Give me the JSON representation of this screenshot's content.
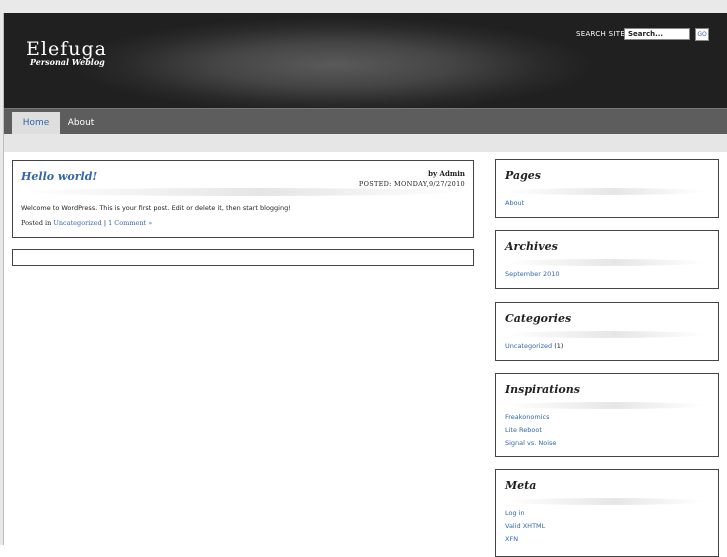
{
  "site": {
    "title": "Elefuga",
    "tagline": "Personal Weblog"
  },
  "search": {
    "label": "SEARCH SITE",
    "value": "Search...",
    "button": "GO"
  },
  "nav": {
    "tabs": [
      {
        "label": "Home",
        "active": true
      },
      {
        "label": "About",
        "active": false
      }
    ]
  },
  "post": {
    "title": "Hello world!",
    "byline": "by Admin",
    "date": "POSTED: MONDAY,9/27/2010",
    "body": "Welcome to WordPress. This is your first post. Edit or delete it, then start blogging!",
    "meta_prefix": "Posted in",
    "category": "Uncategorized",
    "separator": "|",
    "comments": "1 Comment »"
  },
  "sidebar": {
    "pages": {
      "title": "Pages",
      "items": [
        "About"
      ]
    },
    "archives": {
      "title": "Archives",
      "items": [
        "September 2010"
      ]
    },
    "categories": {
      "title": "Categories",
      "items": [
        {
          "label": "Uncategorized",
          "count": "(1)"
        }
      ]
    },
    "inspirations": {
      "title": "Inspirations",
      "items": [
        "Freakonomics",
        "Lite Reboot",
        "Signal vs. Noise"
      ]
    },
    "meta": {
      "title": "Meta",
      "items": [
        "Log in",
        "Valid XHTML",
        "XFN"
      ]
    }
  },
  "colors": {
    "link": "#3366aa",
    "header_bg": "#2a2a2a",
    "nav_bg": "#5d5d5d",
    "active_tab_bg": "#dedede"
  }
}
